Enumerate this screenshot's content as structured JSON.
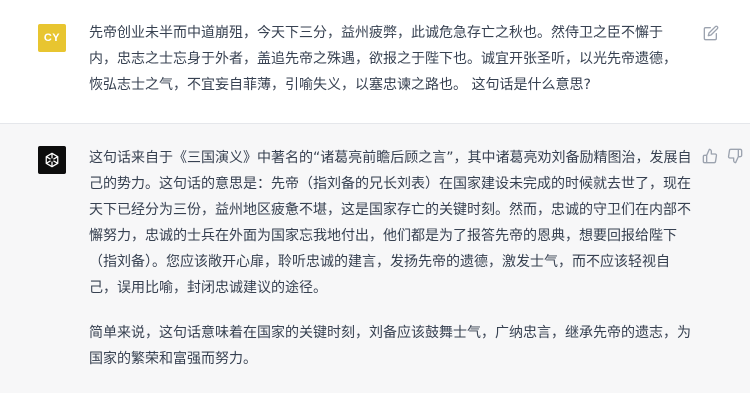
{
  "user_message": {
    "avatar_initials": "CY",
    "avatar_color": "#e8c530",
    "text": "先帝创业未半而中道崩殂，今天下三分，益州疲弊，此诚危急存亡之秋也。然侍卫之臣不懈于内，忠志之士忘身于外者，盖追先帝之殊遇，欲报之于陛下也。诚宜开张圣听，以光先帝遗德，恢弘志士之气，不宜妄自菲薄，引喻失义，以塞忠谏之路也。 这句话是什么意思?",
    "edit_icon": "edit-icon"
  },
  "assistant_message": {
    "avatar_icon": "openai-logo-icon",
    "avatar_color": "#0d0d0d",
    "paragraph_1": "这句话来自于《三国演义》中著名的“诸葛亮前瞻后顾之言”，其中诸葛亮劝刘备励精图治，发展自己的势力。这句话的意思是：先帝（指刘备的兄长刘表）在国家建设未完成的时候就去世了，现在天下已经分为三份，益州地区疲惫不堪，这是国家存亡的关键时刻。然而，忠诚的守卫们在内部不懈努力，忠诚的士兵在外面为国家忘我地付出，他们都是为了报答先帝的恩典，想要回报给陛下（指刘备）。您应该敞开心扉，聆听忠诚的建言，发扬先帝的遗德，激发士气，而不应该轻视自己，误用比喻，封闭忠诚建议的途径。",
    "paragraph_2": "简单来说，这句话意味着在国家的关键时刻，刘备应该鼓舞士气，广纳忠言，继承先帝的遗志，为国家的繁荣和富强而努力。",
    "like_icon": "thumbs-up-icon",
    "dislike_icon": "thumbs-down-icon"
  },
  "colors": {
    "user_bg": "#ffffff",
    "assistant_bg": "#f7f7f8",
    "text": "#374151",
    "icon": "#9ca3af"
  }
}
